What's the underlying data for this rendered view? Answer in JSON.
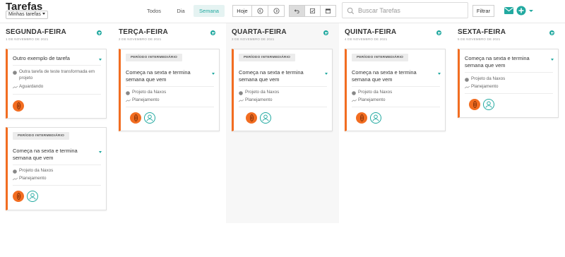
{
  "header": {
    "title": "Tarefas",
    "filter_select": "Minhas tarefas",
    "views": [
      "Todos",
      "Dia",
      "Semana"
    ],
    "active_view": "Semana",
    "today_label": "Hoje",
    "search_placeholder": "Buscar Tarefas",
    "filter_label": "Filtrar"
  },
  "colors": {
    "accent": "#22a9a0",
    "alert": "#f26d21"
  },
  "columns": [
    {
      "title": "SEGUNDA-FEIRA",
      "date": "1 DE NOVEMBRO DE 2021",
      "cards": [
        {
          "title": "Outro exemplo de tarefa",
          "project": "Outra tarefa de teste transformada em projeto",
          "status": "Aguardando"
        },
        {
          "badge": "PERÍODO INTERMEDIÁRIO",
          "title": "Começa na sexta e termina semana que vem",
          "project": "Projeto da Naxos",
          "status": "Planejamento"
        }
      ]
    },
    {
      "title": "TERÇA-FEIRA",
      "date": "2 DE NOVEMBRO DE 2021",
      "cards": [
        {
          "badge": "PERÍODO INTERMEDIÁRIO",
          "title": "Começa na sexta e termina semana que vem",
          "project": "Projeto da Naxos",
          "status": "Planejamento"
        }
      ]
    },
    {
      "title": "QUARTA-FEIRA",
      "date": "3 DE NOVEMBRO DE 2021",
      "cards": [
        {
          "badge": "PERÍODO INTERMEDIÁRIO",
          "title": "Começa na sexta e termina semana que vem",
          "project": "Projeto da Naxos",
          "status": "Planejamento"
        }
      ]
    },
    {
      "title": "QUINTA-FEIRA",
      "date": "4 DE NOVEMBRO DE 2021",
      "cards": [
        {
          "badge": "PERÍODO INTERMEDIÁRIO",
          "title": "Começa na sexta e termina semana que vem",
          "project": "Projeto da Naxos",
          "status": "Planejamento"
        }
      ]
    },
    {
      "title": "SEXTA-FEIRA",
      "date": "5 DE NOVEMBRO DE 2021",
      "cards": [
        {
          "title": "Começa na sexta e termina semana que vem",
          "project": "Projeto da Naxos",
          "status": "Planejamento"
        }
      ]
    }
  ]
}
